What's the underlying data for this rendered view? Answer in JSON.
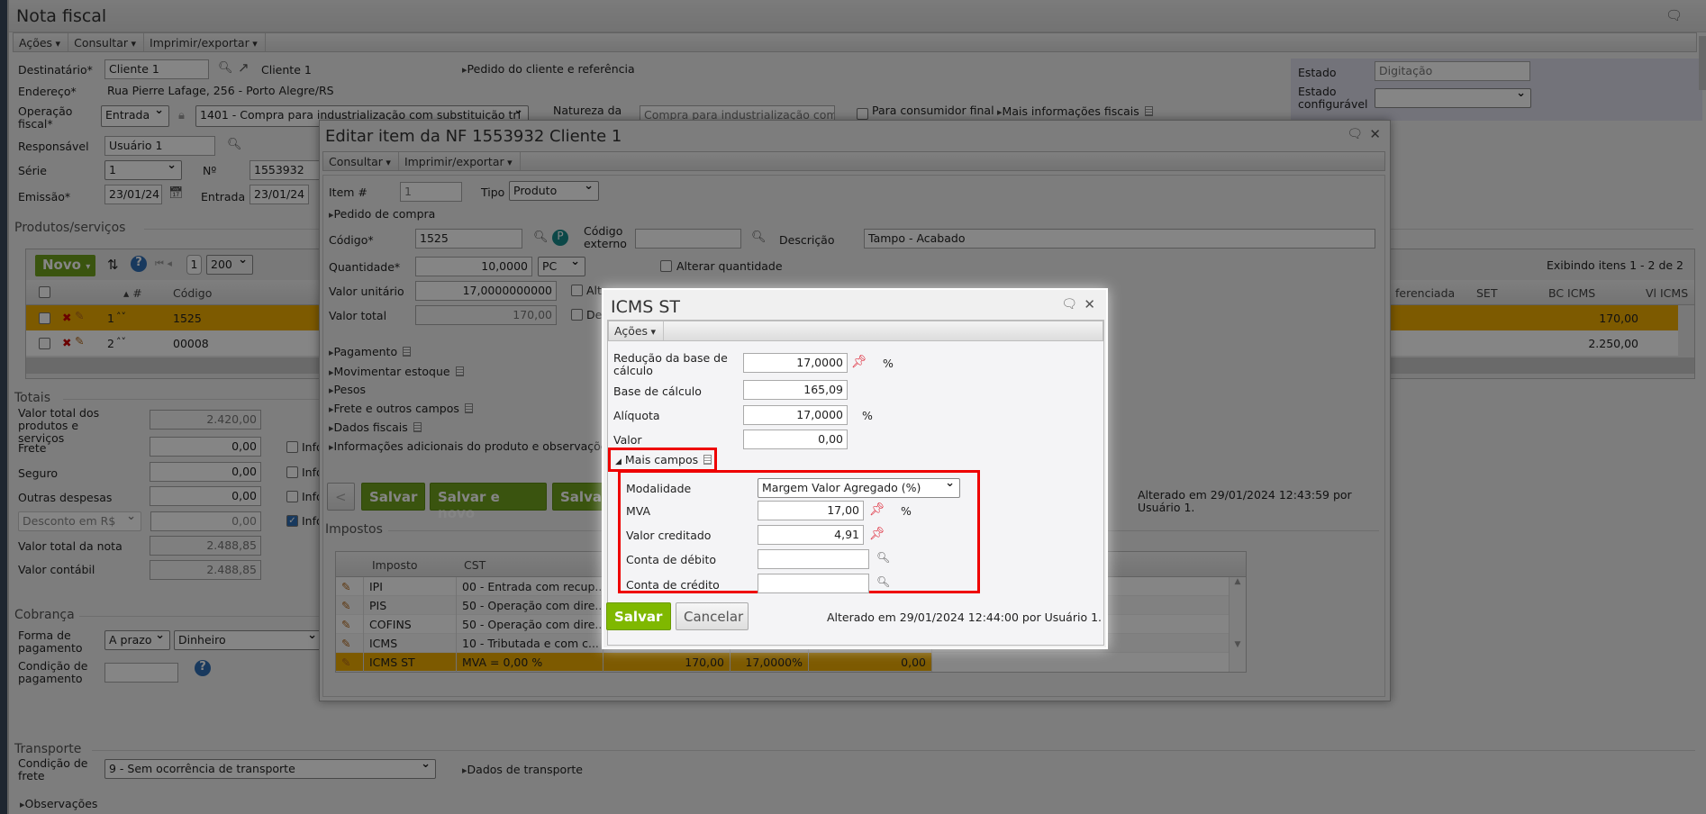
{
  "window": {
    "title": "Nota fiscal",
    "toolbar": [
      "Ações",
      "Consultar",
      "Imprimir/exportar"
    ]
  },
  "header": {
    "destinatario_label": "Destinatário*",
    "destinatario_value": "Cliente 1",
    "destinatario_link": "Cliente 1",
    "pedido_cliente": "Pedido do cliente e referência",
    "endereco_label": "Endereço*",
    "endereco_value": "Rua Pierre Lafage, 256 - Porto Alegre/RS",
    "operacao_label": "Operação fiscal*",
    "operacao_tipo": "Entrada",
    "operacao_value": "1401 - Compra para industrialização com substituição tri",
    "natureza_label": "Natureza da",
    "natureza_value": "Compra para industrialização com s",
    "consumidor_final": "Para consumidor final",
    "mais_info_fiscais": "Mais informações fiscais",
    "responsavel_label": "Responsável",
    "responsavel_value": "Usuário 1",
    "serie_label": "Série",
    "serie_value": "1",
    "numero_label": "Nº",
    "numero_value": "1553932",
    "emissao_label": "Emissão*",
    "emissao_value": "23/01/24",
    "entrada_label": "Entrada",
    "entrada_value": "23/01/24",
    "estado_label": "Estado",
    "estado_value": "Digitação",
    "estado_config_label": "Estado configurável",
    "estado_config_value": ""
  },
  "produtos": {
    "section": "Produtos/serviços",
    "novo": "Novo",
    "page": "1",
    "page_size": "200",
    "summary": "Exibindo itens 1 - 2 de 2",
    "columns": {
      "num": "#",
      "codigo": "Código",
      "diferenciada": "ferenciada",
      "set": "SET",
      "bc_icms": "BC ICMS",
      "vl_icms": "Vl ICMS"
    },
    "rows": [
      {
        "num": "1",
        "codigo": "1525",
        "bc_icms": "170,00"
      },
      {
        "num": "2",
        "codigo": "00008",
        "bc_icms": "2.250,00"
      }
    ]
  },
  "totais": {
    "section": "Totais",
    "rows": [
      {
        "label": "Valor total dos produtos e serviços",
        "value": "2.420,00"
      },
      {
        "label": "Frete",
        "value": "0,00"
      },
      {
        "label": "Seguro",
        "value": "0,00"
      },
      {
        "label": "Outras despesas",
        "value": "0,00"
      },
      {
        "label": "Desconto em R$",
        "value": "0,00"
      },
      {
        "label": "Valor total da nota",
        "value": "2.488,85"
      },
      {
        "label": "Valor contábil",
        "value": "2.488,85"
      }
    ],
    "info_label": "Info"
  },
  "cobranca": {
    "section": "Cobrança",
    "forma_label": "Forma de pagamento",
    "forma_tipo": "A prazo",
    "forma_value": "Dinheiro",
    "condicao_label": "Condição de pagamento",
    "condicao_value": ""
  },
  "transporte": {
    "section": "Transporte",
    "frete_label": "Condição de frete",
    "frete_value": "9 - Sem ocorrência de transporte",
    "dados": "Dados de transporte",
    "observacoes": "Observações"
  },
  "edit": {
    "title": "Editar item da NF 1553932 Cliente 1",
    "toolbar": [
      "Consultar",
      "Imprimir/exportar"
    ],
    "item_label": "Item #",
    "item_value": "1",
    "tipo_label": "Tipo",
    "tipo_value": "Produto",
    "pedido_compra": "Pedido de compra",
    "codigo_label": "Código*",
    "codigo_value": "1525",
    "cod_ext_label": "Código externo",
    "cod_ext_value": "",
    "descricao_label": "Descrição",
    "descricao_value": "Tampo - Acabado",
    "quantidade_label": "Quantidade*",
    "quantidade_value": "10,0000",
    "unidade": "PC",
    "alterar_qtd": "Alterar quantidade",
    "valor_unit_label": "Valor unitário",
    "valor_unit_value": "17,0000000000",
    "alt_label": "Alt",
    "valor_total_label": "Valor total",
    "valor_total_value": "170,00",
    "de_label": "De",
    "sections": [
      "Pagamento",
      "Movimentar estoque",
      "Pesos",
      "Frete e outros campos",
      "Dados fiscais",
      "Informações adicionais do produto e observações"
    ],
    "prev": "<",
    "salvar": "Salvar",
    "salvar_novo": "Salvar e novo",
    "salvar3": "Salva",
    "alterado": "Alterado em 29/01/2024 12:43:59 por Usuário 1.",
    "impostos": "Impostos",
    "tax_columns": {
      "imposto": "Imposto",
      "cst": "CST"
    },
    "taxes": [
      {
        "imposto": "IPI",
        "cst": "00 - Entrada com recup..."
      },
      {
        "imposto": "PIS",
        "cst": "50 - Operação com dire..."
      },
      {
        "imposto": "COFINS",
        "cst": "50 - Operação com dire..."
      },
      {
        "imposto": "ICMS",
        "cst": "10 - Tributada e com c..."
      },
      {
        "imposto": "ICMS ST",
        "cst": "MVA = 0,00 %",
        "bc": "170,00",
        "aliquota": "17,0000%",
        "valor": "0,00"
      }
    ]
  },
  "icms": {
    "title": "ICMS ST",
    "toolbar": "Ações",
    "reducao_label": "Redução da base de cálculo",
    "reducao_value": "17,0000",
    "pct": "%",
    "base_label": "Base de cálculo",
    "base_value": "165,09",
    "aliquota_label": "Alíquota",
    "aliquota_value": "17,0000",
    "valor_label": "Valor",
    "valor_value": "0,00",
    "mais_campos": "Mais campos",
    "modalidade_label": "Modalidade",
    "modalidade_value": "Margem Valor Agregado (%)",
    "mva_label": "MVA",
    "mva_value": "17,00",
    "valor_cred_label": "Valor creditado",
    "valor_cred_value": "4,91",
    "conta_debito_label": "Conta de débito",
    "conta_debito_value": "",
    "conta_credito_label": "Conta de crédito",
    "conta_credito_value": "",
    "salvar": "Salvar",
    "cancelar": "Cancelar",
    "alterado": "Alterado em 29/01/2024 12:44:00 por Usuário 1."
  },
  "colors": {
    "accent_green": "#6fa21e",
    "highlight": "#f0ad00",
    "red_box": "#e00000"
  }
}
